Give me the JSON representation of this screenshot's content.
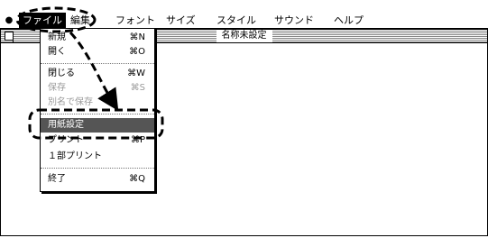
{
  "menubar": {
    "apple_glyph": "",
    "items": [
      "ファイル",
      "編集",
      "フォント",
      "サイズ",
      "スタイル",
      "サウンド",
      "ヘルプ"
    ],
    "active_index": 0
  },
  "window": {
    "title": "名称未設定"
  },
  "file_menu": {
    "items": [
      {
        "label": "新規",
        "shortcut": "⌘N",
        "enabled": true
      },
      {
        "label": "開く",
        "shortcut": "⌘O",
        "enabled": true
      },
      {
        "label": "閉じる",
        "shortcut": "⌘W",
        "enabled": true
      },
      {
        "label": "保存",
        "shortcut": "⌘S",
        "enabled": false
      },
      {
        "label": "別名で保存",
        "shortcut": "",
        "enabled": false
      },
      {
        "label": "用紙設定",
        "shortcut": "",
        "enabled": true,
        "highlighted": true
      },
      {
        "label": "プリント",
        "shortcut": "⌘P",
        "enabled": true
      },
      {
        "label": "１部プリント",
        "shortcut": "",
        "enabled": true
      },
      {
        "label": "終了",
        "shortcut": "⌘Q",
        "enabled": true
      }
    ]
  },
  "annotation_color": "#000000"
}
